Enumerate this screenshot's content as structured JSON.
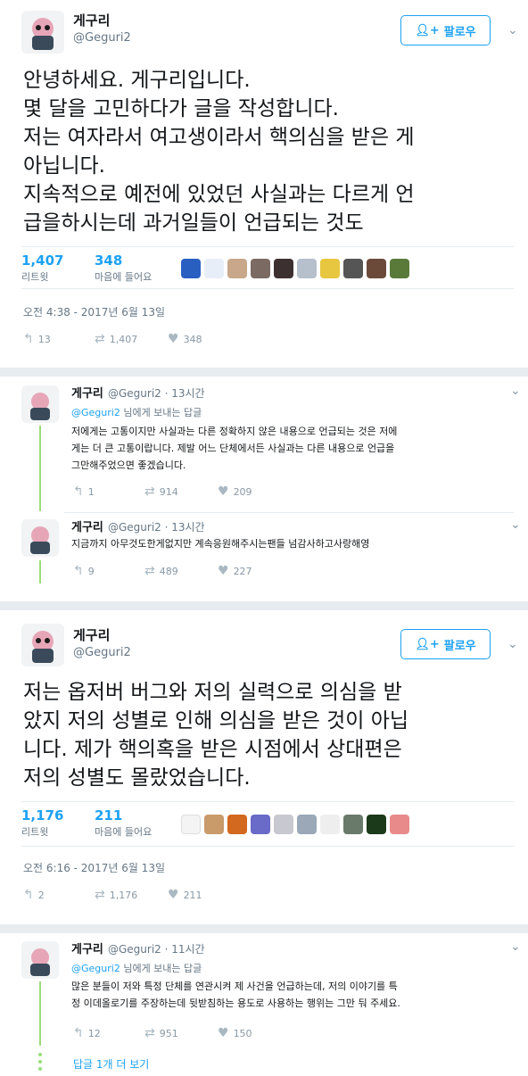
{
  "tweet1": {
    "name": "게구리",
    "handle": "@Geguri2",
    "follow_label": "팔로우",
    "lines": [
      "안녕하세요. 게구리입니다.",
      "몇 달을 고민하다가 글을 작성합니다.",
      "저는 여자라서 여고생이라서 핵의심을 받은 게",
      "아닙니다.",
      "지속적으로 예전에 있었던 사실과는 다르게 언",
      "급을하시는데 과거일들이 언급되는 것도"
    ],
    "retweets": "1,407",
    "retweets_label": "리트윗",
    "likes": "348",
    "likes_label": "마음에 들어요",
    "date": "오전 4:38 - 2017년 6월 13일",
    "reply_count": "13",
    "rt_count": "1,407",
    "like_count": "348"
  },
  "reply1": {
    "name": "게구리",
    "handle": "@Geguri2 · 13시간",
    "reply_to_user": "@Geguri2",
    "reply_to_suffix": " 님에게 보내는 답글",
    "lines": [
      "저에게는 고통이지만 사실과는 다른 정확하지 않은 내용으로 언급되는 것은 저에",
      "게는 더 큰 고통이랍니다. 제발 어느 단체에서든 사실과는 다른 내용으로 언급을",
      "그만해주었으면 좋겠습니다."
    ],
    "reply_count": "1",
    "rt_count": "914",
    "like_count": "209"
  },
  "reply2": {
    "name": "게구리",
    "handle": "@Geguri2 · 13시간",
    "text": "지금까지 아무것도한게없지만 계속응원해주시는팬들 넘감사하고사랑해영",
    "reply_count": "9",
    "rt_count": "489",
    "like_count": "227"
  },
  "tweet2": {
    "name": "게구리",
    "handle": "@Geguri2",
    "follow_label": "팔로우",
    "lines": [
      "저는 옵저버 버그와 저의 실력으로 의심을 받",
      "았지 저의 성별로 인해 의심을 받은 것이 아닙",
      "니다. 제가 핵의혹을 받은 시점에서 상대편은",
      "저의 성별도 몰랐었습니다."
    ],
    "retweets": "1,176",
    "retweets_label": "리트윗",
    "likes": "211",
    "likes_label": "마음에 들어요",
    "date": "오전 6:16 - 2017년 6월 13일",
    "reply_count": "2",
    "rt_count": "1,176",
    "like_count": "211"
  },
  "reply3": {
    "name": "게구리",
    "handle": "@Geguri2 · 11시간",
    "reply_to_user": "@Geguri2",
    "reply_to_suffix": " 님에게 보내는 답글",
    "lines": [
      "많은 분들이 저와 특정 단체를 연관시켜 제 사건을 언급하는데, 저의 이야기를 특",
      "정 이데올로기를 주장하는데 뒷받침하는 용도로 사용하는 행위는 그만 둬 주세요."
    ],
    "reply_count": "12",
    "rt_count": "951",
    "like_count": "150",
    "more_replies": "답글 1개 더 보기"
  },
  "colors": {
    "accent": "#1da1f2",
    "thread": "#9cdb7a",
    "muted": "#657786"
  }
}
